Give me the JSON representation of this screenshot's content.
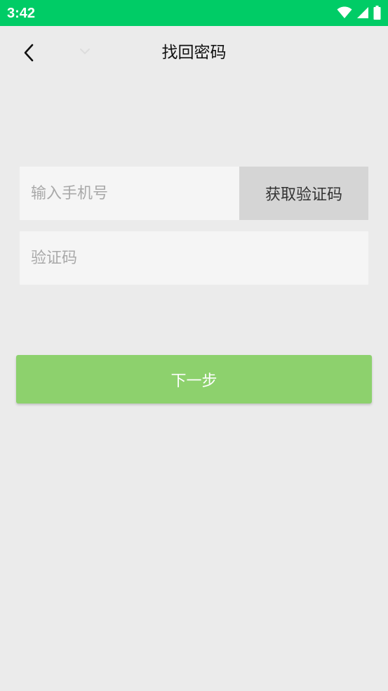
{
  "status_bar": {
    "time": "3:42",
    "icons": [
      "wifi-icon",
      "cellular-signal-icon",
      "battery-icon"
    ]
  },
  "header": {
    "title": "找回密码",
    "back_icon": "chevron-left-icon"
  },
  "form": {
    "phone_placeholder": "输入手机号",
    "phone_value": "",
    "get_code_label": "获取验证码",
    "code_placeholder": "验证码",
    "code_value": ""
  },
  "actions": {
    "next_label": "下一步"
  },
  "colors": {
    "status_bar": "#00cc66",
    "background": "#ebebeb",
    "input_bg": "#f5f5f5",
    "code_button_bg": "#d5d5d5",
    "next_button_bg": "#8dd16d"
  }
}
